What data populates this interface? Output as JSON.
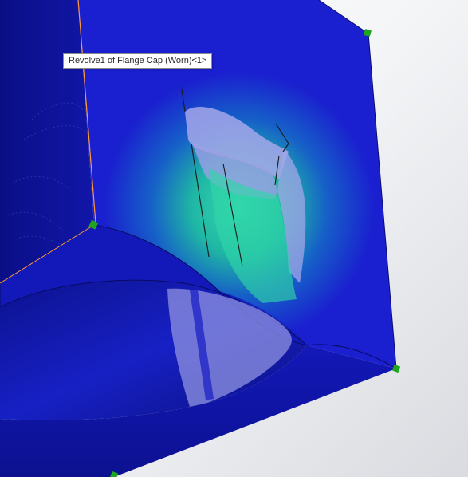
{
  "viewport": {
    "label": "3D model viewport"
  },
  "tooltip": {
    "text": "Revolve1 of Flange Cap (Worn)<1>"
  },
  "colors": {
    "face_blue": "#1a1fcf",
    "face_dark_blue": "#0c128f",
    "wear_teal": "#2fd6a8",
    "wear_light": "#a9a9e8",
    "vertex_green": "#1fa51f",
    "edge_highlight": "#ff9a3c",
    "background": "#f2f3f5"
  },
  "icons": {
    "vertex_markers": "vertex-icon"
  }
}
